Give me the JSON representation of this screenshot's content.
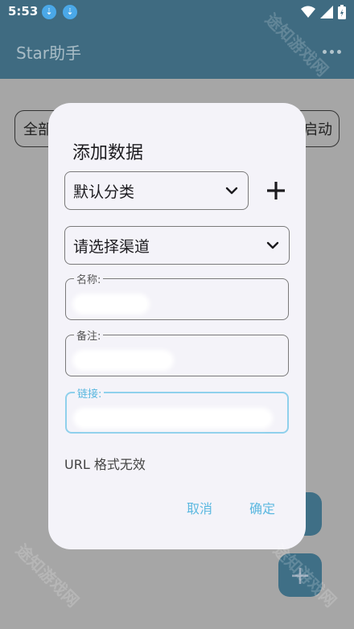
{
  "status": {
    "time": "5:53",
    "download_icon": "⇣"
  },
  "app": {
    "title": "Star助手",
    "filter_left": "全部",
    "filter_right": "启动",
    "fab_label": "+"
  },
  "dialog": {
    "title": "添加数据",
    "category_value": "默认分类",
    "channel_value": "请选择渠道",
    "name_label": "名称:",
    "note_label": "备注:",
    "link_label": "链接:",
    "error_text": "URL 格式无效",
    "cancel_label": "取消",
    "confirm_label": "确定"
  },
  "watermark": {
    "text": "途知游戏网"
  },
  "colors": {
    "accent": "#5bb8e0",
    "appbar": "#3f6b81",
    "dialog_bg": "#f4f3f9"
  }
}
